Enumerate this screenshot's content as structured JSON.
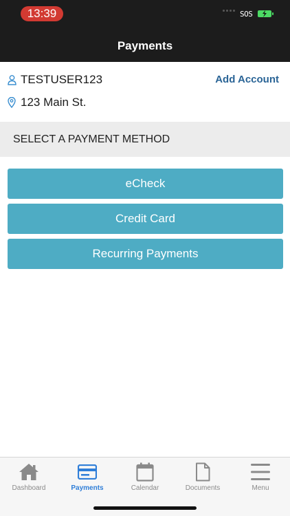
{
  "status_bar": {
    "time": "13:39",
    "carrier": "SOS"
  },
  "header": {
    "title": "Payments"
  },
  "account": {
    "username": "TESTUSER123",
    "address": "123 Main St.",
    "add_account_label": "Add Account"
  },
  "section": {
    "title": "SELECT A PAYMENT METHOD"
  },
  "payment_methods": [
    {
      "label": "eCheck"
    },
    {
      "label": "Credit Card"
    },
    {
      "label": "Recurring Payments"
    }
  ],
  "tabbar": {
    "active": "Payments",
    "items": [
      {
        "label": "Dashboard",
        "icon": "home-icon"
      },
      {
        "label": "Payments",
        "icon": "credit-card-icon"
      },
      {
        "label": "Calendar",
        "icon": "calendar-icon"
      },
      {
        "label": "Documents",
        "icon": "document-icon"
      },
      {
        "label": "Menu",
        "icon": "menu-icon"
      }
    ]
  },
  "colors": {
    "header_bg": "#1c1c1c",
    "button_bg": "#4eacc4",
    "link": "#2a6496",
    "tab_active": "#2f7ed8",
    "time_pill": "#d23a32"
  }
}
